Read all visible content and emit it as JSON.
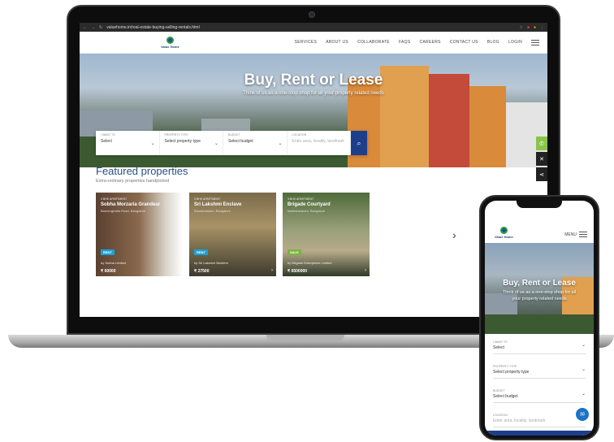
{
  "browser": {
    "url": "valuehome.in/real-estate-buying-selling-rentals.html"
  },
  "site": {
    "logo_text": "Value Home",
    "menu": [
      "SERVICES",
      "ABOUT US",
      "COLLABORATE",
      "FAQS",
      "CAREERS",
      "CONTACT US",
      "BLOG",
      "LOGIN"
    ],
    "hero_title": "Buy, Rent or Lease",
    "hero_subtitle": "Think of us as a one-stop shop for all your property related needs",
    "search": {
      "want_label": "I WANT TO",
      "want_value": "Select",
      "type_label": "PROPERTY TYPE",
      "type_value": "Select property type",
      "budget_label": "BUDGET",
      "budget_value": "Select budget",
      "location_label": "LOCATION",
      "location_placeholder": "Enter area, locality, landmark"
    },
    "featured_title": "Featured properties",
    "featured_subtitle": "Extra-ordinary properties handpicked",
    "cards": [
      {
        "type": "3 BHK APARTMENT",
        "name": "Sobha Morzaria Grandeur",
        "address": "Bannerghatta Road, Bangalore",
        "badge": "RENT",
        "builder": "by Sobha Limited",
        "price": "₹ 60000"
      },
      {
        "type": "3 BHK APARTMENT",
        "name": "Sri Lakshmi Enclave",
        "address": "Banashankari, Bangalore",
        "badge": "RENT",
        "builder": "by Sri Lakshmi Builders",
        "price": "₹ 27500"
      },
      {
        "type": "3 BHK APARTMENT",
        "name": "Brigade Courtyard",
        "address": "Malleshwaram, Bangalore",
        "badge": "SALE",
        "builder": "by Brigade Enterprises Limited",
        "price": "₹ 6500000"
      }
    ]
  },
  "mobile": {
    "menu_label": "MENU",
    "hero_title": "Buy, Rent or Lease",
    "hero_subtitle": "Think of us as a one-stop shop for all your property related needs",
    "fields": [
      {
        "label": "I WANT TO",
        "value": "Select"
      },
      {
        "label": "PROPERTY TYPE",
        "value": "Select property type"
      },
      {
        "label": "BUDGET",
        "value": "Select budget"
      },
      {
        "label": "LOCATION",
        "value": "Enter area, locality, landmark"
      }
    ]
  },
  "colors": {
    "brand_blue": "#1d3f8b",
    "accent_green": "#8bc34a",
    "rent_badge": "#1aa3d6",
    "sale_badge": "#7cb342"
  }
}
